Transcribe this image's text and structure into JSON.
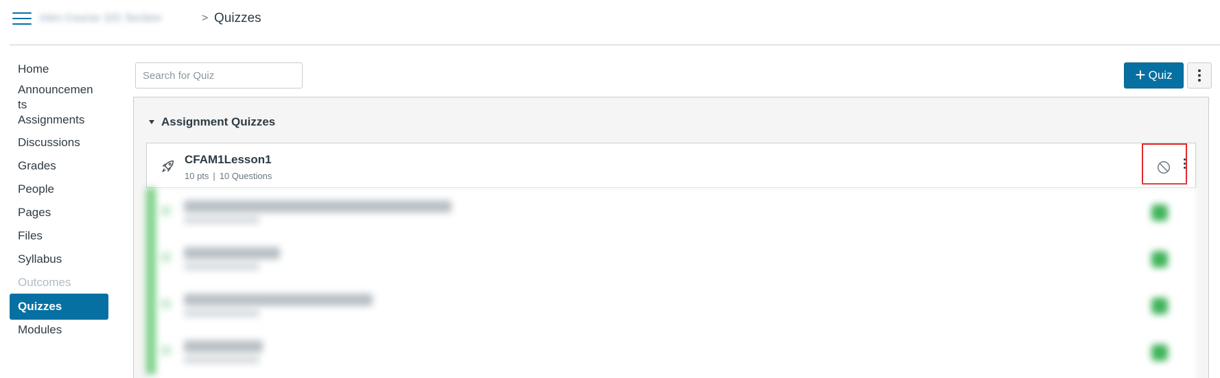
{
  "header": {
    "course_name": "Intro Course 101 Section",
    "separator": ">",
    "current_page": "Quizzes"
  },
  "nav": {
    "items": [
      {
        "label": "Home"
      },
      {
        "label": "Announcements"
      },
      {
        "label": "Assignments"
      },
      {
        "label": "Discussions"
      },
      {
        "label": "Grades"
      },
      {
        "label": "People"
      },
      {
        "label": "Pages"
      },
      {
        "label": "Files"
      },
      {
        "label": "Syllabus"
      },
      {
        "label": "Outcomes",
        "disabled": true
      },
      {
        "label": "Quizzes",
        "active": true
      },
      {
        "label": "Modules"
      }
    ]
  },
  "toolbar": {
    "search_placeholder": "Search for Quiz",
    "add_quiz_label": "Quiz"
  },
  "group": {
    "title": "Assignment Quizzes",
    "quizzes": [
      {
        "title": "CFAM1Lesson1",
        "points": "10 pts",
        "separator": "|",
        "questions": "10 Questions",
        "published": false
      }
    ]
  },
  "colors": {
    "brand": "#0770a3",
    "published": "#3fb35a",
    "highlight": "#e0292e"
  },
  "icons": {
    "menu": "hamburger-icon",
    "quiz": "rocket-icon",
    "unpublished": "unpublished-icon",
    "more": "kebab-icon"
  }
}
